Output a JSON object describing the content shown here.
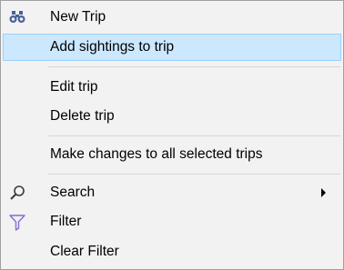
{
  "menu": {
    "items": [
      {
        "label": "New Trip",
        "icon": "binoculars-icon"
      },
      {
        "label": "Add sightings to trip",
        "highlighted": true
      },
      {
        "label": "Edit trip"
      },
      {
        "label": "Delete trip"
      },
      {
        "label": "Make changes to all selected trips"
      },
      {
        "label": "Search",
        "icon": "magnifier-icon",
        "submenu": true
      },
      {
        "label": "Filter",
        "icon": "funnel-icon"
      },
      {
        "label": "Clear Filter"
      }
    ]
  },
  "colors": {
    "menu_bg": "#f2f2f2",
    "highlight_bg": "#cce8ff",
    "highlight_border": "#99d1ff",
    "icon_blue": "#4a5f9b",
    "funnel_purple": "#8a6bd6"
  }
}
